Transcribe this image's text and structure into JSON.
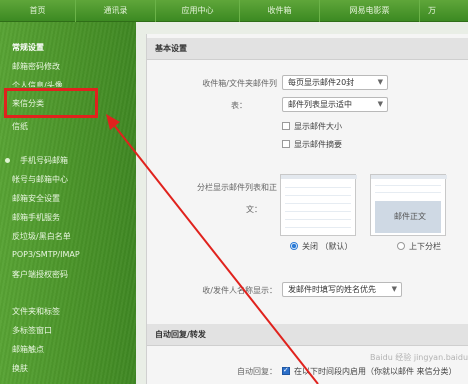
{
  "topnav": {
    "tabs": [
      "首页",
      "通讯录",
      "应用中心",
      "收件箱",
      "网易电影票",
      "万"
    ]
  },
  "sidebar": {
    "items": [
      {
        "label": "常规设置",
        "head": true
      },
      {
        "label": "邮箱密码修改"
      },
      {
        "label": "个人信息/头像"
      },
      {
        "label": "来信分类"
      },
      {
        "label": "信纸"
      },
      {
        "label": "手机号码邮箱"
      },
      {
        "label": "帐号与邮箱中心"
      },
      {
        "label": "邮箱安全设置"
      },
      {
        "label": "邮箱手机服务"
      },
      {
        "label": "反垃圾/黑白名单"
      },
      {
        "label": "POP3/SMTP/IMAP"
      },
      {
        "label": "客户端授权密码"
      },
      {
        "label": "文件夹和标签"
      },
      {
        "label": "多标签窗口"
      },
      {
        "label": "邮箱触点"
      },
      {
        "label": "换肤"
      }
    ]
  },
  "main": {
    "basic_title": "基本设置",
    "mailbox_label_1": "收件箱/文件夹邮件列",
    "mailbox_label_2": "表：",
    "per_page_select": "每页显示邮件20封",
    "list_display_select": "邮件列表显示适中",
    "show_size": "显示邮件大小",
    "show_summary": "显示邮件摘要",
    "split_label_1": "分栏显示邮件列表和正",
    "split_label_2": "文：",
    "preview_text": "邮件正文",
    "radio_off": "关闭 （默认）",
    "radio_updown": "上下分栏",
    "sender_label": "收/发件人名称显示：",
    "sender_select": "发邮件时填写的姓名优先",
    "auto_title": "自动回复/转发",
    "auto_reply_label": "自动回复：",
    "auto_reply_text": "在以下时间段内启用（你就以邮件 来信分类）"
  },
  "watermark": "Baidu 经验 jingyan.baidu.com"
}
